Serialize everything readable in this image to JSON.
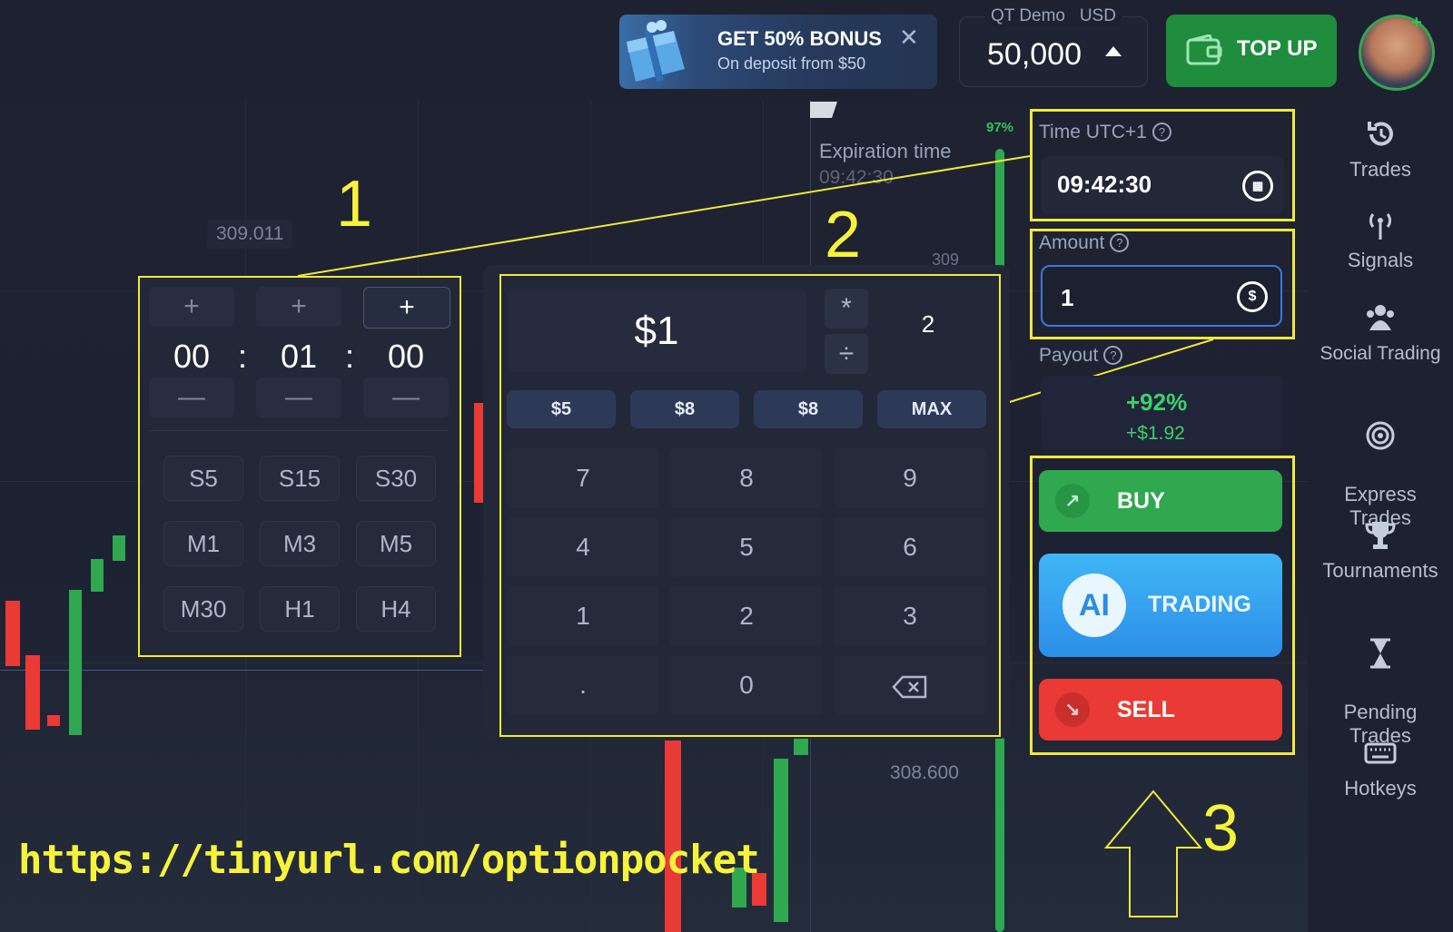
{
  "header": {
    "bonus": {
      "title": "GET 50% BONUS",
      "subtitle": "On deposit from $50",
      "close": "✕"
    },
    "account": {
      "name": "QT Demo   USD",
      "balance": "50,000"
    },
    "topup_label": "TOP UP"
  },
  "chart": {
    "price_label_1": "309.011",
    "price_label_2": "308.600",
    "price_label_3": "309",
    "expiration_label": "Expiration time",
    "expiration_value": "09:42:30",
    "percent_up": "97%"
  },
  "timer": {
    "plus": "+",
    "minus": "—",
    "hours": "00",
    "minutes": "01",
    "seconds": "00",
    "separator": ":",
    "presets": [
      "S5",
      "S15",
      "S30",
      "M1",
      "M3",
      "M5",
      "M30",
      "H1",
      "H4"
    ]
  },
  "keypad": {
    "amount": "$1",
    "multiply": "*",
    "divide": "÷",
    "multiplier": "2",
    "quick": [
      "$5",
      "$8",
      "$8",
      "MAX"
    ],
    "keys": [
      "7",
      "8",
      "9",
      "4",
      "5",
      "6",
      "1",
      "2",
      "3",
      ".",
      "0"
    ]
  },
  "trade": {
    "time_label": "Time UTC+1",
    "time_value": "09:42:30",
    "amount_label": "Amount",
    "amount_value": "1",
    "payout_label": "Payout",
    "payout_percent": "+92%",
    "payout_amount": "+$1.92",
    "buy": "BUY",
    "ai_badge": "AI",
    "ai_label": "TRADING",
    "sell": "SELL",
    "help": "?"
  },
  "sidebar": {
    "items": [
      {
        "label": "Trades",
        "icon": "history-icon"
      },
      {
        "label": "Signals",
        "icon": "antenna-icon"
      },
      {
        "label": "Social Trading",
        "icon": "people-icon"
      },
      {
        "label": "Express\nTrades",
        "icon": "target-icon"
      },
      {
        "label": "Tournaments",
        "icon": "trophy-icon"
      },
      {
        "label": "Pending\nTrades",
        "icon": "hourglass-icon"
      },
      {
        "label": "Hotkeys",
        "icon": "keyboard-icon"
      }
    ]
  },
  "annotations": {
    "n1": "1",
    "n2": "2",
    "n3": "3",
    "url": "https://tinyurl.com/optionpocket"
  },
  "colors": {
    "accent_yellow": "#f0e93a",
    "buy_green": "#2fa84f",
    "sell_red": "#ea3a35",
    "ai_blue": "#2d8ee8"
  }
}
